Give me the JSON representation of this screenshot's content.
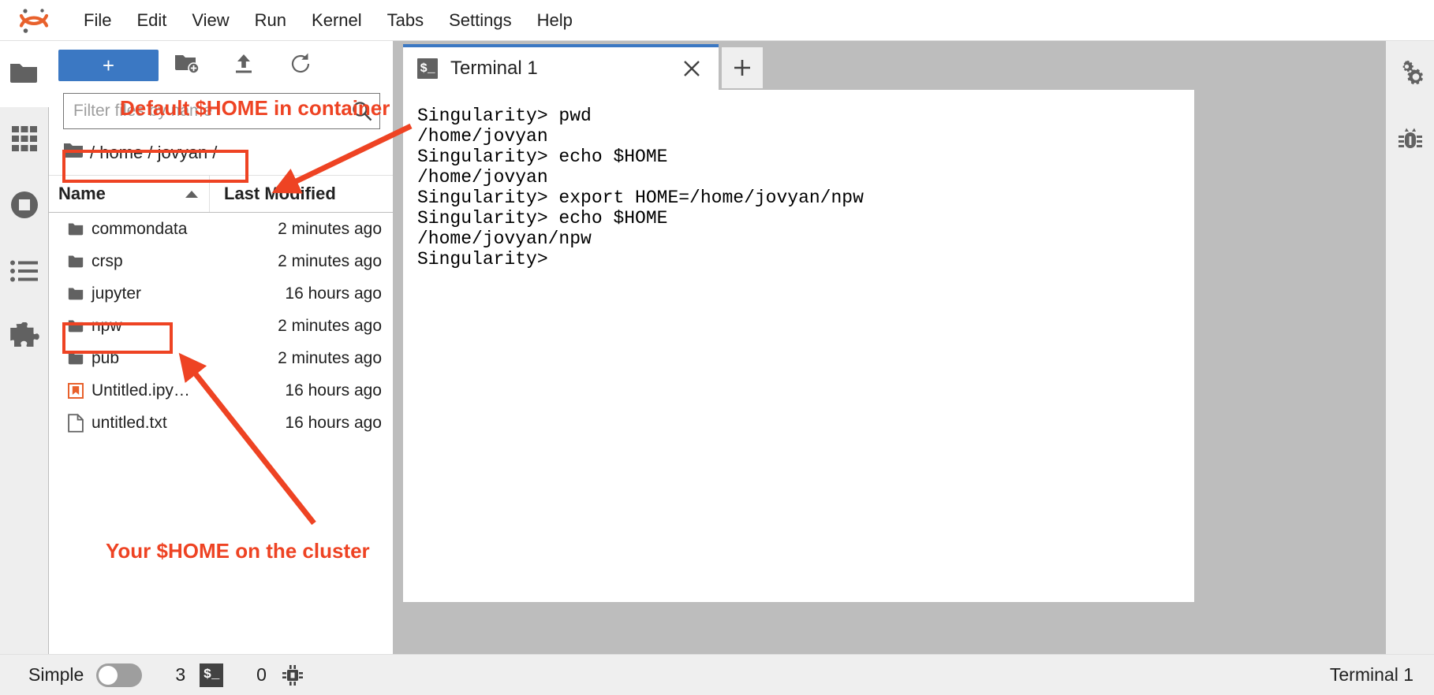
{
  "app": {
    "logo_name": "jupyter-logo",
    "accent_blue": "#3b78c3",
    "annotation_red": "#ee4323"
  },
  "menubar": {
    "items": [
      {
        "label": "File"
      },
      {
        "label": "Edit"
      },
      {
        "label": "View"
      },
      {
        "label": "Run"
      },
      {
        "label": "Kernel"
      },
      {
        "label": "Tabs"
      },
      {
        "label": "Settings"
      },
      {
        "label": "Help"
      }
    ]
  },
  "left_sidebar": {
    "items": [
      {
        "name": "file-browser",
        "icon": "folder-icon",
        "active": true
      },
      {
        "name": "launcher",
        "icon": "grid-icon",
        "active": false
      },
      {
        "name": "running-terminals-kernels",
        "icon": "stop-circle-icon",
        "active": false
      },
      {
        "name": "table-of-contents",
        "icon": "list-icon",
        "active": false
      },
      {
        "name": "extension-manager",
        "icon": "puzzle-icon",
        "active": false
      }
    ]
  },
  "right_sidebar": {
    "items": [
      {
        "name": "property-inspector",
        "icon": "gears-icon"
      },
      {
        "name": "debugger",
        "icon": "bug-icon"
      }
    ]
  },
  "file_browser": {
    "toolbar": {
      "new_launcher_label": "+",
      "new_folder_icon": "new-folder-icon",
      "upload_icon": "upload-icon",
      "refresh_icon": "refresh-icon"
    },
    "filter": {
      "placeholder": "Filter files by name",
      "value": "",
      "search_icon": "search-icon"
    },
    "breadcrumb": {
      "icon": "folder-icon",
      "parts": [
        "/",
        "home",
        "/",
        "jovyan",
        "/"
      ],
      "text": "/ home / jovyan /"
    },
    "columns": {
      "name": "Name",
      "last_modified": "Last Modified",
      "sort_direction": "ascending"
    },
    "rows": [
      {
        "icon": "folder-icon",
        "name": "commondata",
        "modified": "2 minutes ago"
      },
      {
        "icon": "folder-icon",
        "name": "crsp",
        "modified": "2 minutes ago"
      },
      {
        "icon": "folder-icon",
        "name": "jupyter",
        "modified": "16 hours ago"
      },
      {
        "icon": "folder-icon",
        "name": "npw",
        "modified": "2 minutes ago"
      },
      {
        "icon": "folder-icon",
        "name": "pub",
        "modified": "2 minutes ago"
      },
      {
        "icon": "notebook-icon",
        "name": "Untitled.ipy…",
        "modified": "16 hours ago"
      },
      {
        "icon": "textfile-icon",
        "name": "untitled.txt",
        "modified": "16 hours ago"
      }
    ]
  },
  "dock": {
    "tabs": [
      {
        "label": "Terminal 1",
        "icon": "terminal-icon",
        "active": true,
        "close_icon": "close-icon"
      }
    ],
    "add_tab_label": "+"
  },
  "terminal": {
    "lines": [
      "Singularity> pwd",
      "/home/jovyan",
      "Singularity> echo $HOME",
      "/home/jovyan",
      "Singularity> export HOME=/home/jovyan/npw",
      "Singularity> echo $HOME",
      "/home/jovyan/npw",
      "Singularity>"
    ]
  },
  "statusbar": {
    "simple_label": "Simple",
    "simple_toggle_on": false,
    "terminal_count": "3",
    "terminal_icon": "terminal-icon",
    "kernel_count": "0",
    "kernel_icon": "kernel-icon",
    "active_item": "Terminal 1"
  },
  "annotations": [
    {
      "id": "ann-home-container",
      "text": "Default $HOME in container",
      "color": "#ee4323"
    },
    {
      "id": "ann-home-cluster",
      "text": "Your $HOME on the cluster",
      "color": "#ee4323"
    }
  ]
}
